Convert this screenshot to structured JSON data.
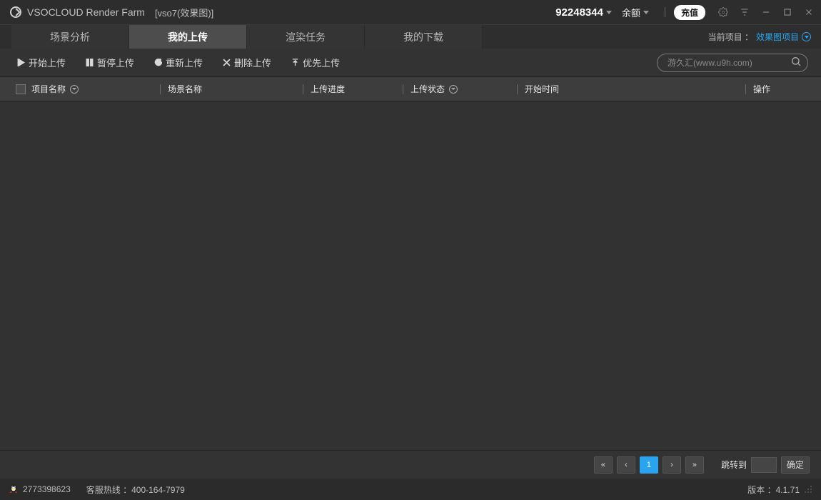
{
  "titlebar": {
    "app_name": "VSOCLOUD Render Farm",
    "sub": "[vso7(效果图)]",
    "account_id": "92248344",
    "balance_label": "余额",
    "recharge": "充值"
  },
  "tabs": {
    "items": [
      "场景分析",
      "我的上传",
      "渲染任务",
      "我的下载"
    ],
    "active_index": 1,
    "current_project_label": "当前项目 ：",
    "current_project_value": "效果图项目"
  },
  "toolbar": {
    "start": "开始上传",
    "pause": "暂停上传",
    "refresh": "重新上传",
    "delete": "删除上传",
    "priority": "优先上传",
    "search_placeholder": "游久汇(www.u9h.com)"
  },
  "columns": {
    "c1": "项目名称",
    "c2": "场景名称",
    "c3": "上传进度",
    "c4": "上传状态",
    "c5": "开始时间",
    "c6": "操作"
  },
  "pager": {
    "page": "1",
    "jump_label": "跳转到",
    "go": "确定"
  },
  "status": {
    "qq": "2773398623",
    "hotline_label": "客服热线 ：",
    "hotline_num": "400-164-7979",
    "version_label": "版本 ：",
    "version_num": "4.1.71"
  }
}
